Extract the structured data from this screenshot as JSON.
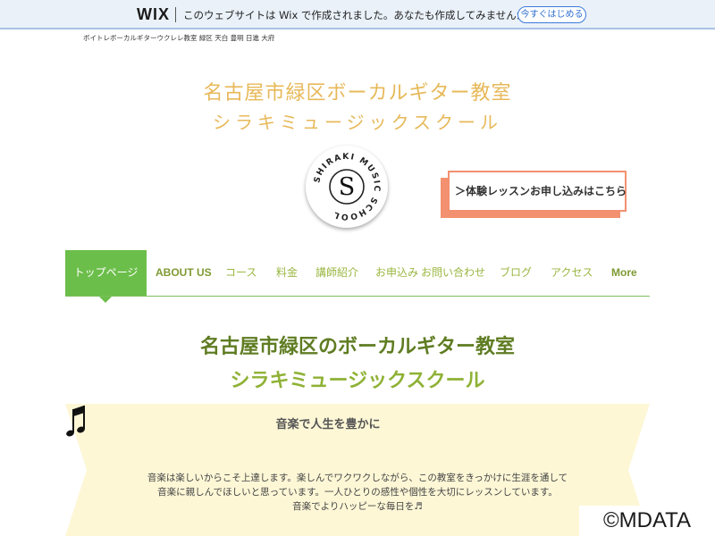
{
  "wix_banner": {
    "logo": "WIX",
    "message": "このウェブサイトは Wix で作成されました。あなたも作成してみませんか？",
    "cta_label": "今すぐはじめる",
    "colors": {
      "background": "#eaf1f9",
      "border": "#a9c3e5",
      "cta": "#2f6fd1"
    }
  },
  "tagline": "ボイトレボーカルギターウクレレ教室 緑区 天白 豊明 日進 大府",
  "site_title": {
    "line1": "名古屋市緑区ボーカルギター教室",
    "line2": "シラキミュージックスクール",
    "color": "#e7b95a"
  },
  "logo": {
    "ring_text": "SHIRAKI MUSIC SCHOOL",
    "letter": "S"
  },
  "lesson_button": {
    "label": "＞体験レッスンお申し込みはこちら",
    "accent": "#f3906f"
  },
  "nav": {
    "items": [
      {
        "label": "トップページ",
        "active": true
      },
      {
        "label": "ABOUT US"
      },
      {
        "label": "コース"
      },
      {
        "label": "料金"
      },
      {
        "label": "講師紹介"
      },
      {
        "label": "お申込み"
      },
      {
        "label": "お問い合わせ"
      },
      {
        "label": "ブログ"
      },
      {
        "label": "アクセス"
      },
      {
        "label": "More"
      }
    ],
    "active_color": "#6cbe4a",
    "text_color": "#9ab742"
  },
  "main": {
    "title1": "名古屋市緑区のボーカルギター教室",
    "title2": "シラキミュージックスクール",
    "colors": {
      "title1": "#5f7c22",
      "title2": "#8fb236"
    }
  },
  "panel": {
    "heading": "音楽で人生を豊かに",
    "icon": "music-note-icon",
    "body": [
      "音楽は楽しいからこそ上達します。楽しんでワクワクしながら、この教室をきっかけに生涯を通して",
      "音楽に親しんでほしいと思っています。一人ひとりの感性や個性を大切にレッスンしています。",
      "音楽でよりハッピーな毎日を♬"
    ],
    "background": "#fdf7d6"
  },
  "watermark": "©MDATA"
}
